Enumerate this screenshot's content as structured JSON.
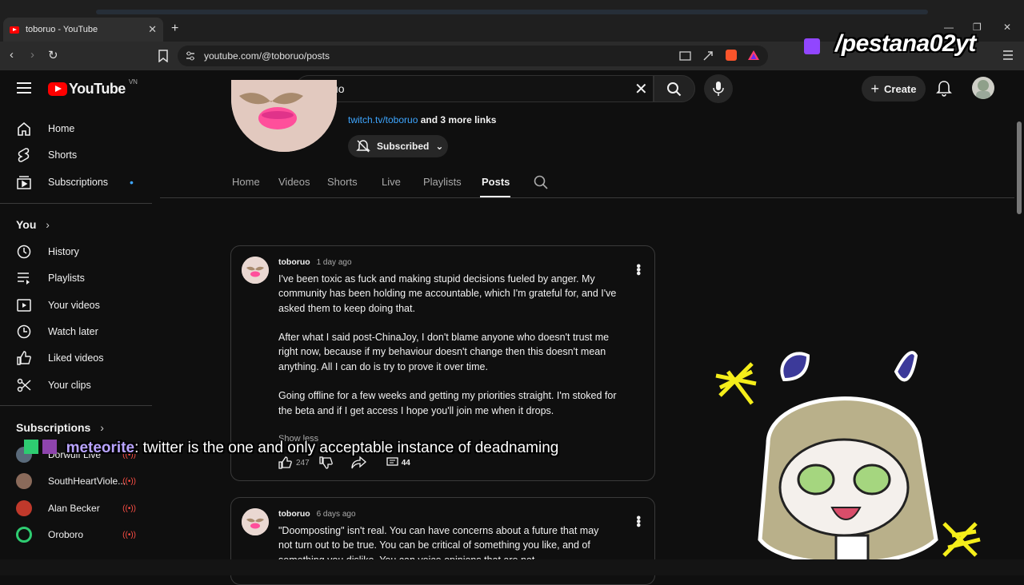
{
  "browser": {
    "tab_title": "toboruo - YouTube",
    "tab_close": "✕",
    "new_tab": "+",
    "url": "youtube.com/@toboruo/posts"
  },
  "youtube": {
    "logo_text": "YouTube",
    "country_code": "VN",
    "search_value": "toboruo",
    "create_label": "Create"
  },
  "sidebar": {
    "main": [
      {
        "label": "Home",
        "icon": "home-icon"
      },
      {
        "label": "Shorts",
        "icon": "shorts-icon"
      },
      {
        "label": "Subscriptions",
        "icon": "subscriptions-icon"
      }
    ],
    "you_heading": "You",
    "you": [
      {
        "label": "History",
        "icon": "history-icon"
      },
      {
        "label": "Playlists",
        "icon": "playlists-icon"
      },
      {
        "label": "Your videos",
        "icon": "your-videos-icon"
      },
      {
        "label": "Watch later",
        "icon": "watch-later-icon"
      },
      {
        "label": "Liked videos",
        "icon": "liked-videos-icon"
      },
      {
        "label": "Your clips",
        "icon": "clips-icon"
      }
    ],
    "subscriptions_heading": "Subscriptions",
    "subscriptions": [
      {
        "label": "Dorwulf Live",
        "color": "#5a6a7a"
      },
      {
        "label": "SouthHeartViole...",
        "color": "#8a6a5a"
      },
      {
        "label": "Alan Becker",
        "color": "#c0392b"
      },
      {
        "label": "Oroboro",
        "color": "#2ecc71"
      }
    ]
  },
  "channel": {
    "link_text": "twitch.tv/toboruo",
    "more_links": "and 3 more links",
    "subscribed_label": "Subscribed",
    "tabs": [
      "Home",
      "Videos",
      "Shorts",
      "Live",
      "Playlists",
      "Posts"
    ],
    "active_tab": "Posts"
  },
  "posts": [
    {
      "author": "toboruo",
      "time": "1 day ago",
      "text": "I've been toxic as fuck and making stupid decisions fueled by anger. My community has been holding me accountable, which I'm grateful for, and I've asked them to keep doing that.\n\nAfter what I said post-ChinaJoy, I don't blame anyone who doesn't trust me right now, because if my behaviour doesn't change then this doesn't mean anything. All I can do is try to prove it over time.\n\nGoing offline for a few weeks and getting my priorities straight. I'm stoked for the beta and if I get access I hope you'll join me when it drops.",
      "show_less": "Show less",
      "likes": "247",
      "comments": "44"
    },
    {
      "author": "toboruo",
      "time": "6 days ago",
      "text": "\"Doomposting\" isn't real. You can have concerns about a future that may not turn out to be true. You can be critical of something you like, and of something you dislike. You can voice opinions that are not"
    }
  ],
  "overlay": {
    "watermark": "/pestana02yt",
    "chat_user": "meteorite",
    "chat_message": "twitter is the one and only acceptable instance of deadnaming"
  }
}
